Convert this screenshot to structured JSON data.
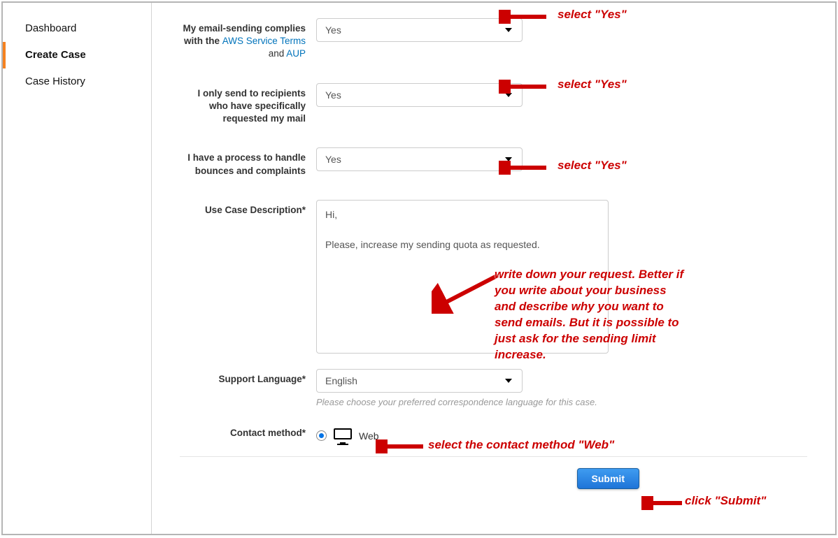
{
  "sidebar": {
    "items": [
      {
        "label": "Dashboard",
        "active": false
      },
      {
        "label": "Create Case",
        "active": true
      },
      {
        "label": "Case History",
        "active": false
      }
    ]
  },
  "labels": {
    "compliance_pre": "My email-sending complies with the ",
    "link_service_terms": "AWS Service Terms",
    "and": " and ",
    "link_aup": "AUP",
    "recipients": "I only send to recipients who have specifically requested my mail",
    "bounces": "I have a process to handle bounces and complaints",
    "use_case": "Use Case Description*",
    "support_lang": "Support Language*",
    "contact_method": "Contact method*"
  },
  "values": {
    "compliance": "Yes",
    "recipients": "Yes",
    "bounces": "Yes",
    "use_case_text": "Hi,\n\nPlease, increase my sending quota as requested.",
    "support_lang": "English",
    "contact_method": "Web"
  },
  "help": {
    "support_lang": "Please choose your preferred correspondence language for this case."
  },
  "buttons": {
    "submit": "Submit"
  },
  "annotations": {
    "select_yes": "select \"Yes\"",
    "write_request": "write down your request. Better if you write about your business and describe why you want to send emails. But it is possible to just ask for the sending limit increase.",
    "select_web": "select the contact method \"Web\"",
    "click_submit": "click \"Submit\""
  }
}
